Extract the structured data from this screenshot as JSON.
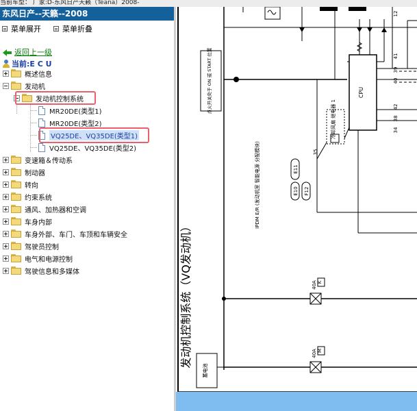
{
  "topbar": {
    "text": "当前车型：  厂家:D-东风日产天籁（Teana）2008-"
  },
  "window": {
    "title": "东风日产--天籁--2008"
  },
  "menu": {
    "expand": "菜单展开",
    "collapse": "菜单折叠"
  },
  "nav": {
    "back": "返回上一级",
    "current": "当前:E C U"
  },
  "tree": {
    "items": [
      {
        "label": "概述信息"
      },
      {
        "label": "发动机"
      },
      {
        "label": "发动机控制系统"
      },
      {
        "label": "MR20DE(类型1)"
      },
      {
        "label": "MR20DE(类型2)"
      },
      {
        "label": "VQ25DE、VQ35DE(类型1)"
      },
      {
        "label": "VQ25DE、VQ35DE(类型2)"
      },
      {
        "label": "变速箱＆传动系"
      },
      {
        "label": "制动器"
      },
      {
        "label": "转向"
      },
      {
        "label": "约束系统"
      },
      {
        "label": "通风、加热器和空调"
      },
      {
        "label": "车身内部"
      },
      {
        "label": "车身外部、车门、车顶和车辆安全"
      },
      {
        "label": "驾驶员控制"
      },
      {
        "label": "电气和电源控制"
      },
      {
        "label": "驾驶信息和多媒体"
      }
    ]
  },
  "diagram": {
    "title": "发动机控制系统（VQ发动机）",
    "ignition_label": "点火开关处于 ON 或 START 位置",
    "relay_label": "冷却风扇 继电器 1",
    "cpu_label": "CPU",
    "ipdm_label": "IPDM E/R (发动机室 智能电源 分配模块)",
    "conn_e11": "E11",
    "conn_e10": "E10",
    "conn_f12": "F12",
    "fuse1_amp": "40A",
    "fuse1_code": "K",
    "fuse2_amp": "40A",
    "fuse2_code": "M",
    "battery_label": "蓄电池",
    "pins": {
      "p12": "12",
      "p41": "41",
      "p39": "39",
      "p40": "40",
      "p42": "42",
      "p38": "38",
      "p34": "34",
      "p35": "35"
    }
  },
  "colors": {
    "title_bar": "#14609a",
    "highlight_box": "#e8606c",
    "footer_strip": "#7fbdf0"
  }
}
